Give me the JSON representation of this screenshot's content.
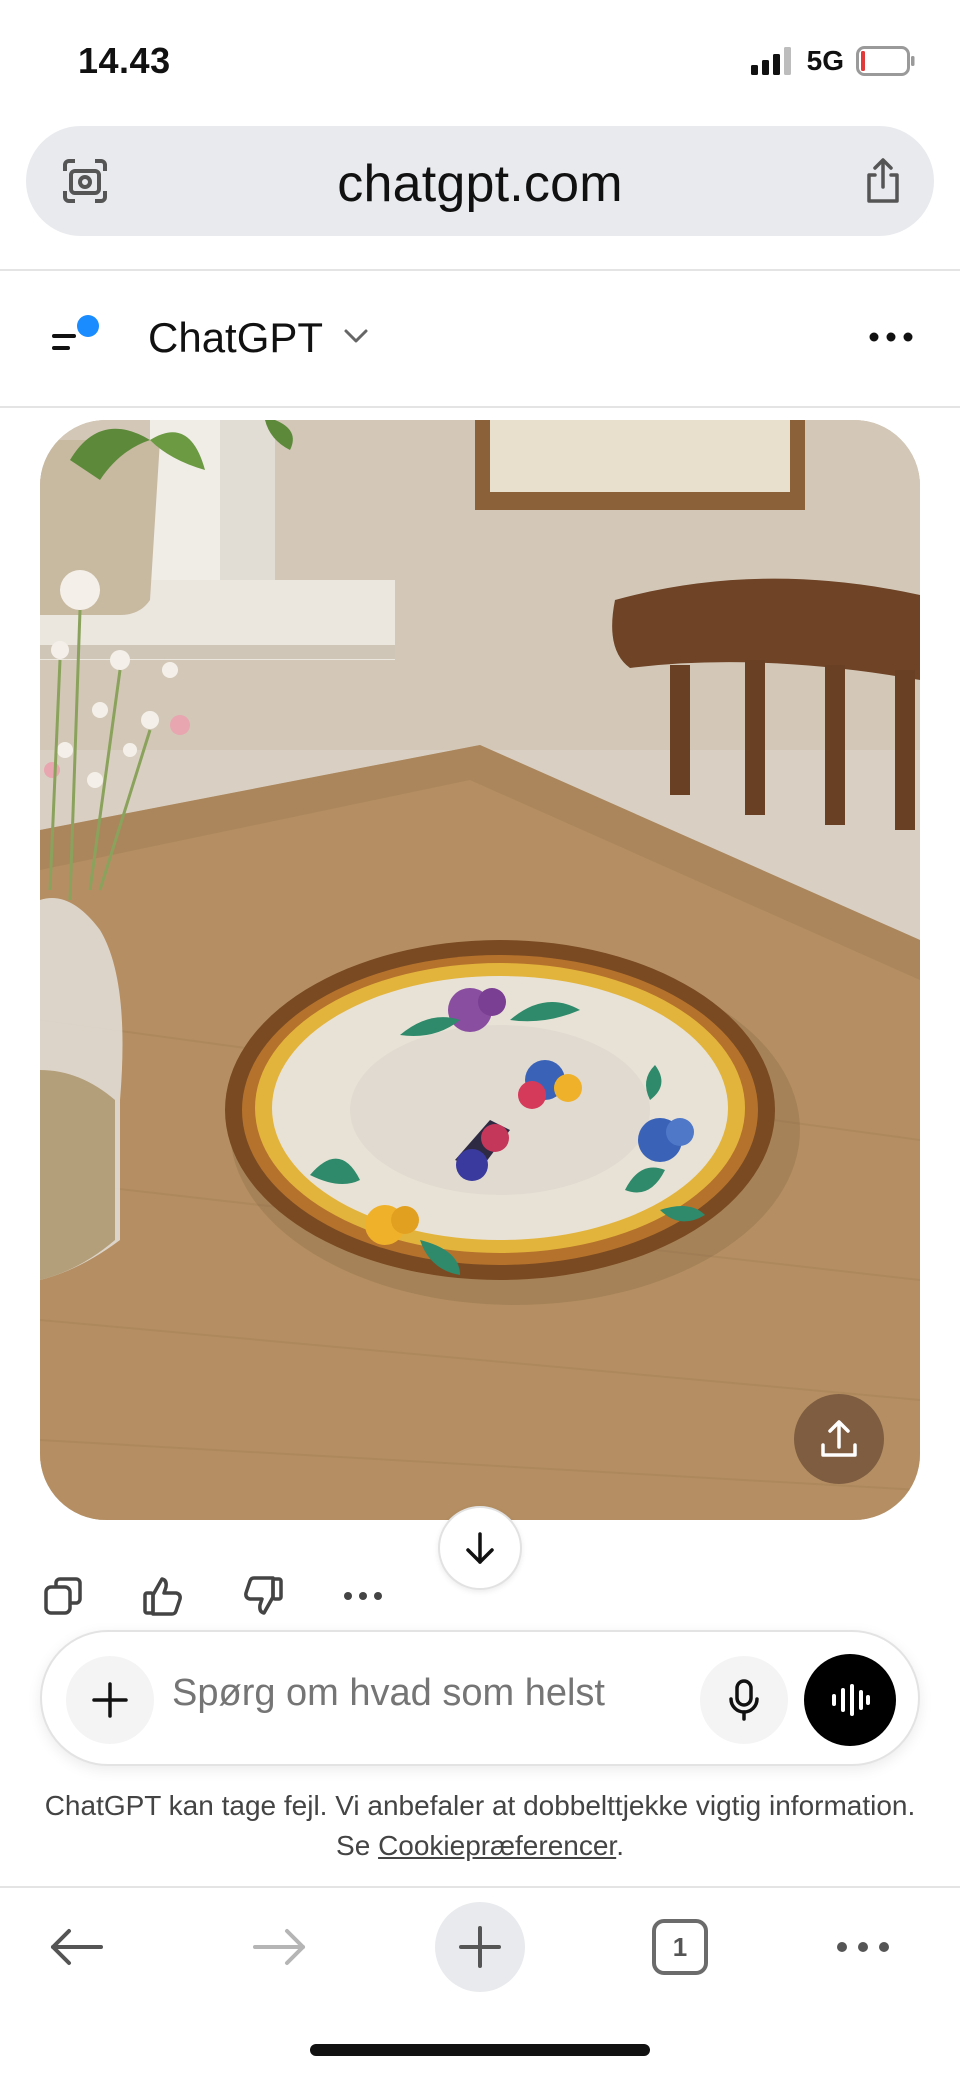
{
  "status": {
    "time": "14.43",
    "network": "5G"
  },
  "browser": {
    "url": "chatgpt.com",
    "tab_count": "1"
  },
  "chat": {
    "model_name": "ChatGPT"
  },
  "composer": {
    "placeholder": "Spørg om hvad som helst"
  },
  "disclaimer": {
    "text_before": "ChatGPT kan tage fejl. Vi anbefaler at dobbelttjekke vigtig information. Se ",
    "link": "Cookiepræferencer",
    "text_after": "."
  },
  "colors": {
    "accent_dot": "#1a8cff",
    "voice_button": "#000000",
    "toolbar_bg": "#e8eaed"
  },
  "icons": [
    "lens-icon",
    "share-icon",
    "sidebar-menu-icon",
    "chevron-down-icon",
    "more-icon",
    "upload-icon",
    "arrow-down-icon",
    "copy-icon",
    "thumbs-up-icon",
    "thumbs-down-icon",
    "plus-icon",
    "mic-icon",
    "voice-mode-icon",
    "back-icon",
    "forward-icon",
    "new-tab-icon",
    "tabs-icon"
  ]
}
